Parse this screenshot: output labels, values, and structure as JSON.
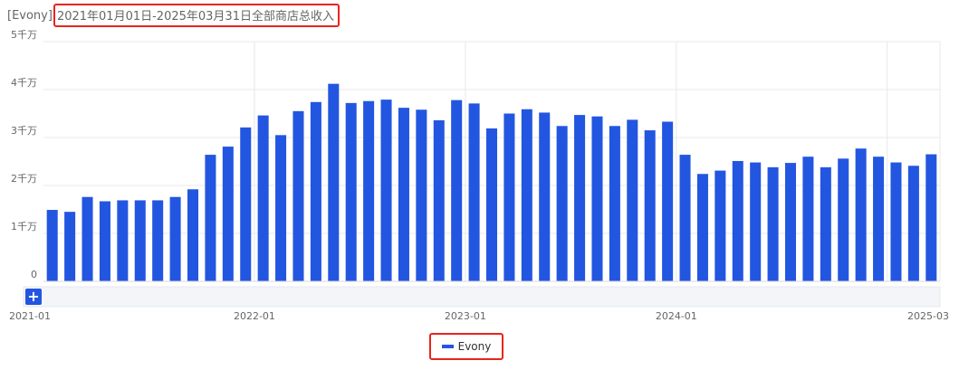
{
  "header": {
    "app_label": "[Evony]",
    "title": "2021年01月01日-2025年03月31日全部商店总收入"
  },
  "legend": {
    "label": "Evony"
  },
  "zoom_control": {
    "plus_label": "+"
  },
  "colors": {
    "bar": "#2356e0",
    "grid": "#e8e8e8",
    "highlight_border": "#e8251b",
    "slider_bg": "#f3f5f8"
  },
  "chart_data": {
    "type": "bar",
    "title": "2021年01月01日-2025年03月31日全部商店总收入",
    "xlabel": "",
    "ylabel": "",
    "y_unit": "万",
    "ylim": [
      0,
      50000000
    ],
    "y_ticks": [
      {
        "value": 0,
        "label": "0"
      },
      {
        "value": 10000000,
        "label": "1千万"
      },
      {
        "value": 20000000,
        "label": "2千万"
      },
      {
        "value": 30000000,
        "label": "3千万"
      },
      {
        "value": 40000000,
        "label": "4千万"
      },
      {
        "value": 50000000,
        "label": "5千万"
      }
    ],
    "x_tick_labels": [
      "2021-01",
      "2022-01",
      "2023-01",
      "2024-01",
      "2025-03"
    ],
    "grid": true,
    "legend_position": "bottom-center",
    "categories": [
      "2021-01",
      "2021-02",
      "2021-03",
      "2021-04",
      "2021-05",
      "2021-06",
      "2021-07",
      "2021-08",
      "2021-09",
      "2021-10",
      "2021-11",
      "2021-12",
      "2022-01",
      "2022-02",
      "2022-03",
      "2022-04",
      "2022-05",
      "2022-06",
      "2022-07",
      "2022-08",
      "2022-09",
      "2022-10",
      "2022-11",
      "2022-12",
      "2023-01",
      "2023-02",
      "2023-03",
      "2023-04",
      "2023-05",
      "2023-06",
      "2023-07",
      "2023-08",
      "2023-09",
      "2023-10",
      "2023-11",
      "2023-12",
      "2024-01",
      "2024-02",
      "2024-03",
      "2024-04",
      "2024-05",
      "2024-06",
      "2024-07",
      "2024-08",
      "2024-09",
      "2024-10",
      "2024-11",
      "2024-12",
      "2025-01",
      "2025-02",
      "2025-03"
    ],
    "series": [
      {
        "name": "Evony",
        "values": [
          14900000,
          14500000,
          17600000,
          16700000,
          16900000,
          16900000,
          16900000,
          17600000,
          19200000,
          26400000,
          28100000,
          32100000,
          34600000,
          30500000,
          35500000,
          37400000,
          41200000,
          37200000,
          37600000,
          37900000,
          36200000,
          35800000,
          33600000,
          37800000,
          37100000,
          31900000,
          35000000,
          35900000,
          35200000,
          32400000,
          34700000,
          34400000,
          32400000,
          33700000,
          31500000,
          33300000,
          26400000,
          22400000,
          23100000,
          25100000,
          24800000,
          23800000,
          24700000,
          26000000,
          23800000,
          25600000,
          27700000,
          26000000,
          24800000,
          24100000,
          26500000
        ]
      }
    ]
  }
}
